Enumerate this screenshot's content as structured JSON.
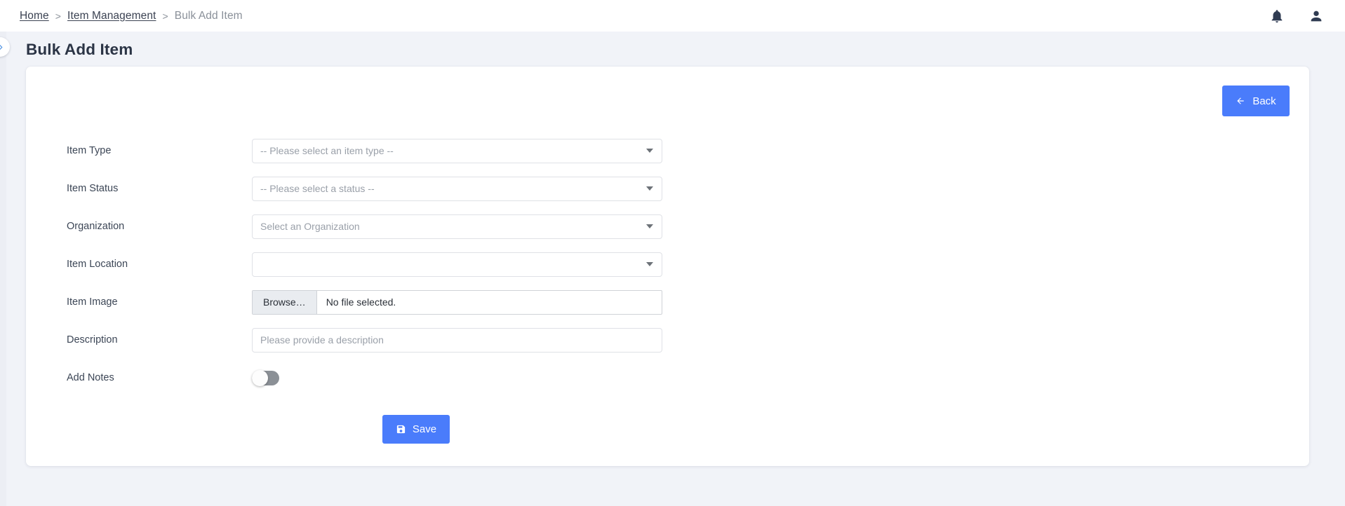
{
  "header": {
    "breadcrumb": {
      "home": "Home",
      "separator": ">",
      "section": "Item Management",
      "current": "Bulk Add Item"
    },
    "icons": {
      "notifications": "bell-icon",
      "account": "user-icon"
    }
  },
  "sidebar": {
    "toggle_icon": "chevron-right-icon"
  },
  "page": {
    "title": "Bulk Add Item"
  },
  "card": {
    "back_button": {
      "label": "Back",
      "icon": "arrow-left-icon",
      "color": "#4a7cfb"
    },
    "fields": [
      {
        "label": "Item Type",
        "type": "select",
        "value": "-- Please select an item type --",
        "name": "item-type"
      },
      {
        "label": "Item Status",
        "type": "select",
        "value": "-- Please select a status --",
        "name": "item-status"
      },
      {
        "label": "Organization",
        "type": "select",
        "value": "Select an Organization",
        "name": "organization"
      },
      {
        "label": "Item Location",
        "type": "select",
        "value": "",
        "name": "item-location"
      },
      {
        "label": "Item Image",
        "type": "file",
        "browse_label": "Browse…",
        "file_status": "No file selected.",
        "name": "item-image"
      },
      {
        "label": "Description",
        "type": "text",
        "value": "",
        "placeholder": "Please provide a description",
        "name": "description"
      },
      {
        "label": "Add Notes",
        "type": "toggle",
        "state": "off",
        "name": "add-notes"
      }
    ],
    "save_button": {
      "label": "Save",
      "icon": "save-floppy-icon",
      "color": "#4a7cfb"
    }
  },
  "colors": {
    "accent": "#4a7cfb",
    "page_background": "#f1f3f8",
    "card_background": "#ffffff",
    "label_text": "#3c4656",
    "placeholder_text": "#9aa0a9"
  }
}
